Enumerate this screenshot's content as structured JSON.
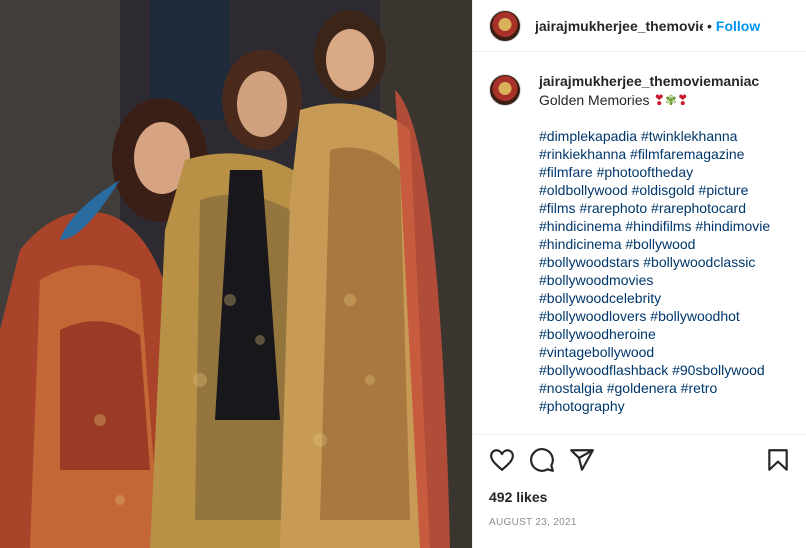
{
  "post": {
    "image": {
      "alt_icon": "photo-of-three-women-in-embroidered-lehengas",
      "accent_colors": [
        "#2b2a30",
        "#b8893e",
        "#c94a2a",
        "#1d1d22"
      ]
    },
    "header": {
      "username": "jairajmukherjee_themoviemaniac",
      "separator": "•",
      "follow_label": "Follow"
    },
    "caption": {
      "username": "jairajmukherjee_themoviemaniac",
      "text": "Golden Memories",
      "emojis": [
        "❣",
        "✾",
        "❣"
      ],
      "hashtag_lines": [
        "#dimplekapadia #twinklekhanna",
        "#rinkiekhanna #filmfaremagazine",
        "#filmfare #photooftheday",
        "#oldbollywood #oldisgold #picture",
        "#films #rarephoto #rarephotocard",
        "#hindicinema #hindifilms #hindimovie",
        "#hindicinema #bollywood",
        "#bollywoodstars #bollywoodclassic",
        "#bollywoodmovies",
        "#bollywoodcelebrity",
        "#bollywoodlovers #bollywoodhot",
        "#bollywoodheroine",
        "#vintagebollywood",
        "#bollywoodflashback #90sbollywood",
        "#nostalgia #goldenera #retro",
        "#photography"
      ]
    },
    "actions": {
      "icons": [
        "heart-icon",
        "comment-icon",
        "share-icon",
        "bookmark-icon"
      ]
    },
    "likes": "492 likes",
    "date": "AUGUST 23, 2021",
    "colors": {
      "link": "#00376b",
      "follow": "#0095f6",
      "muted": "#8e8e8e",
      "border": "#efefef"
    }
  }
}
